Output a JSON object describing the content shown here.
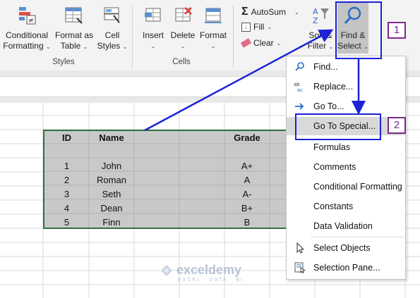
{
  "ribbon": {
    "styles": {
      "conditional_formatting": {
        "line1": "Conditional",
        "line2": "Formatting"
      },
      "format_as_table": {
        "line1": "Format as",
        "line2": "Table"
      },
      "cell_styles": {
        "line1": "Cell",
        "line2": "Styles"
      },
      "group_label": "Styles"
    },
    "cells": {
      "insert": "Insert",
      "delete": "Delete",
      "format": "Format",
      "group_label": "Cells"
    },
    "editing": {
      "autosum": "AutoSum",
      "fill": "Fill",
      "clear": "Clear",
      "sort_filter": {
        "line1": "Sort &",
        "line2": "Filter"
      },
      "find_select": {
        "line1": "Find &",
        "line2": "Select"
      }
    }
  },
  "table": {
    "headers": [
      "ID",
      "Name",
      "Grade"
    ],
    "rows": [
      {
        "id": "1",
        "name": "John",
        "grade": "A+"
      },
      {
        "id": "2",
        "name": "Roman",
        "grade": "A"
      },
      {
        "id": "3",
        "name": "Seth",
        "grade": "A-"
      },
      {
        "id": "4",
        "name": "Dean",
        "grade": "B+"
      },
      {
        "id": "5",
        "name": "Finn",
        "grade": "B"
      }
    ]
  },
  "menu": {
    "items": [
      {
        "label": "Find...",
        "icon": "magnifier-icon"
      },
      {
        "label": "Replace...",
        "icon": "replace-icon"
      },
      {
        "label": "Go To...",
        "icon": "arrow-right-icon"
      },
      {
        "label": "Go To Special...",
        "icon": "none"
      },
      {
        "label": "Formulas",
        "icon": "none"
      },
      {
        "label": "Comments",
        "icon": "none"
      },
      {
        "label": "Conditional Formatting",
        "icon": "none"
      },
      {
        "label": "Constants",
        "icon": "none"
      },
      {
        "label": "Data Validation",
        "icon": "none"
      },
      {
        "label": "Select Objects",
        "icon": "cursor-icon"
      },
      {
        "label": "Selection Pane...",
        "icon": "selection-pane-icon"
      }
    ]
  },
  "annotations": {
    "step1": "1",
    "step2": "2"
  },
  "watermark": {
    "brand": "exceldemy",
    "tagline": "EXCEL · DATA · BI"
  },
  "colors": {
    "annotation_blue": "#1c22d6",
    "annotation_purple": "#7b2a8c",
    "table_border": "#2e7040",
    "selection_gray": "#c9c9c9"
  }
}
